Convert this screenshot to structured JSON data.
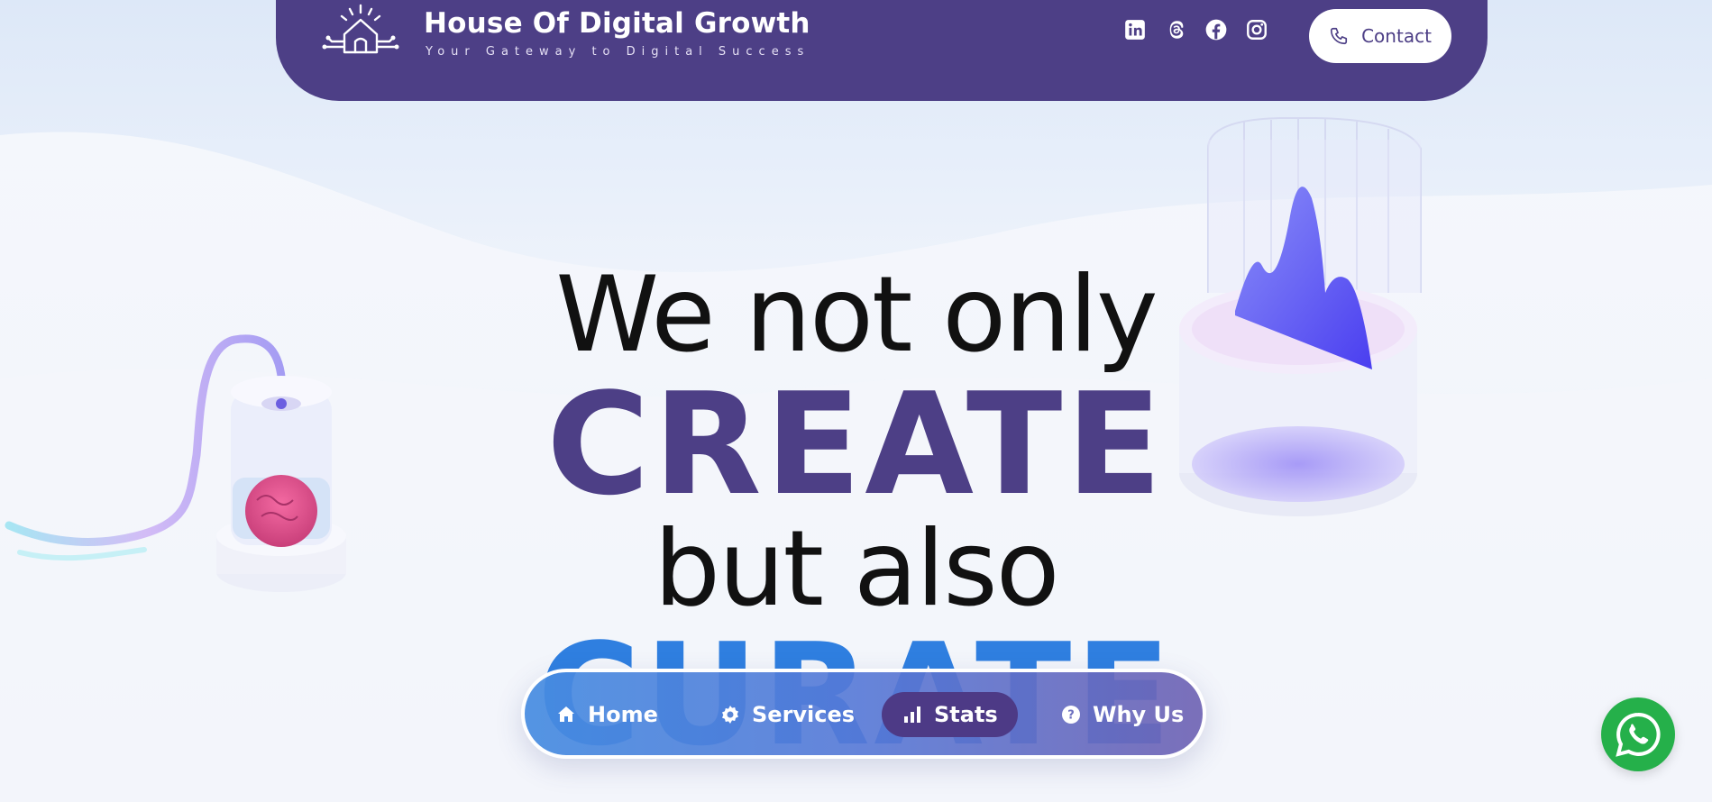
{
  "header": {
    "brand_title": "House Of Digital Growth",
    "brand_tagline": "Your Gateway to Digital Success",
    "social_icons": [
      "linkedin-icon",
      "threads-icon",
      "facebook-icon",
      "instagram-icon"
    ],
    "contact_label": "Contact"
  },
  "hero": {
    "line1": "We not only",
    "line2": "CREATE",
    "line3": "but also",
    "line4": "CURATE"
  },
  "nav": {
    "items": [
      {
        "label": "Home",
        "icon": "home-icon"
      },
      {
        "label": "Services",
        "icon": "gear-icon"
      },
      {
        "label": "Stats",
        "icon": "bar-chart-icon",
        "active": true
      },
      {
        "label": "Why Us",
        "icon": "question-icon"
      }
    ]
  },
  "floating": {
    "whatsapp_icon": "whatsapp-icon"
  },
  "colors": {
    "brand_purple": "#4d3f86",
    "accent_blue": "#2f7fe0",
    "whatsapp_green": "#25b04a"
  }
}
